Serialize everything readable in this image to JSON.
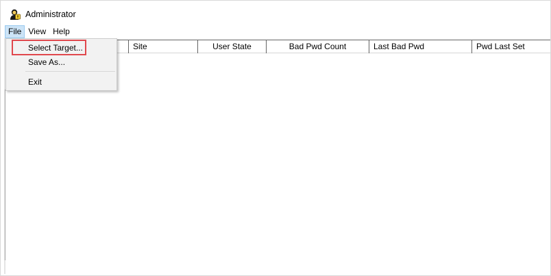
{
  "window": {
    "title": "Administrator",
    "icon": "user-key-icon"
  },
  "menubar": {
    "items": [
      {
        "label": "File",
        "active": true
      },
      {
        "label": "View"
      },
      {
        "label": "Help"
      }
    ]
  },
  "file_menu": {
    "items": [
      {
        "label": "Select Target...",
        "highlighted": true
      },
      {
        "label": "Save As..."
      },
      {
        "label": "Exit"
      }
    ]
  },
  "table": {
    "columns": [
      "",
      "Site",
      "User State",
      "Bad Pwd Count",
      "Last Bad Pwd",
      "Pwd Last Set"
    ],
    "rows": []
  },
  "colors": {
    "highlight_border": "#e0474c",
    "active_menu_bg": "#cce4f7",
    "menu_bg": "#f2f2f2"
  }
}
